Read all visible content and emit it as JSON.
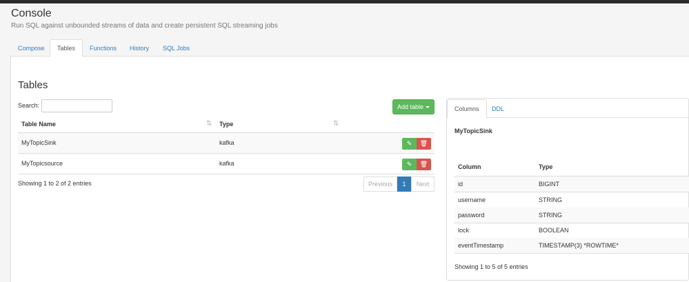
{
  "header": {
    "title": "Console",
    "subtitle": "Run SQL against unbounded streams of data and create persistent SQL streaming jobs"
  },
  "tabs": [
    "Compose",
    "Tables",
    "Functions",
    "History",
    "SQL Jobs"
  ],
  "active_tab": "Tables",
  "tables_section": {
    "heading": "Tables",
    "search_label": "Search:",
    "search_value": "",
    "add_button": "Add table",
    "columns": [
      "Table Name",
      "Type"
    ],
    "rows": [
      {
        "name": "MyTopicSink",
        "type": "kafka"
      },
      {
        "name": "MyTopicsource",
        "type": "kafka"
      }
    ],
    "info": "Showing 1 to 2 of 2 entries",
    "pagination": {
      "previous": "Previous",
      "current": "1",
      "next": "Next"
    }
  },
  "detail_panel": {
    "tabs": [
      "Columns",
      "DDL"
    ],
    "active_tab": "Columns",
    "selected_table": "MyTopicSink",
    "columns_header": [
      "Column",
      "Type"
    ],
    "columns": [
      {
        "column": "id",
        "type": "BIGINT"
      },
      {
        "column": "username",
        "type": "STRING"
      },
      {
        "column": "password",
        "type": "STRING"
      },
      {
        "column": "lock",
        "type": "BOOLEAN"
      },
      {
        "column": "eventTimestamp",
        "type": "TIMESTAMP(3) *ROWTIME*"
      }
    ],
    "info": "Showing 1 to 5 of 5 entries"
  },
  "colors": {
    "accent": "#337ab7",
    "success": "#5cb85c",
    "danger": "#d9534f"
  },
  "icons": {
    "edit": "pencil-icon",
    "delete": "trash-icon",
    "sort": "sort-icon"
  }
}
